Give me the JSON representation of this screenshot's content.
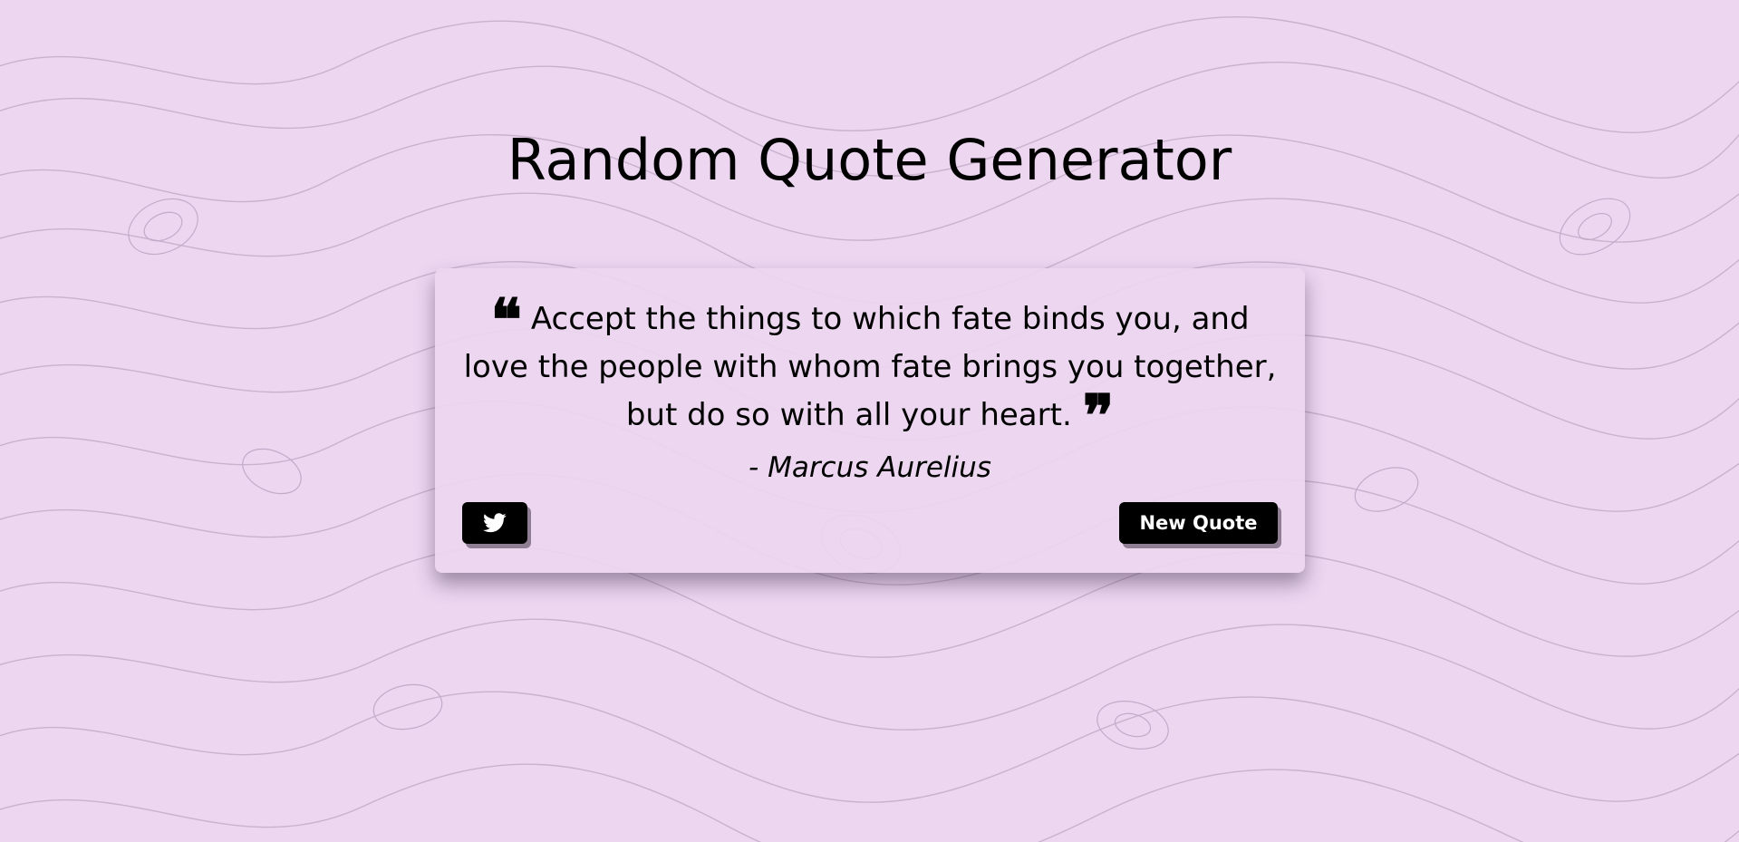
{
  "page": {
    "title": "Random Quote Generator",
    "background_color": "#ecd6f0"
  },
  "quote": {
    "open_mark": "❝",
    "text": "Accept the things to which fate binds you, and love the people with whom fate brings you together, but do so with all your heart.",
    "close_mark": "❞",
    "author": "- Marcus Aurelius"
  },
  "actions": {
    "tweet_icon": "twitter-icon",
    "new_quote_label": "New Quote",
    "button_color": "#000000"
  }
}
